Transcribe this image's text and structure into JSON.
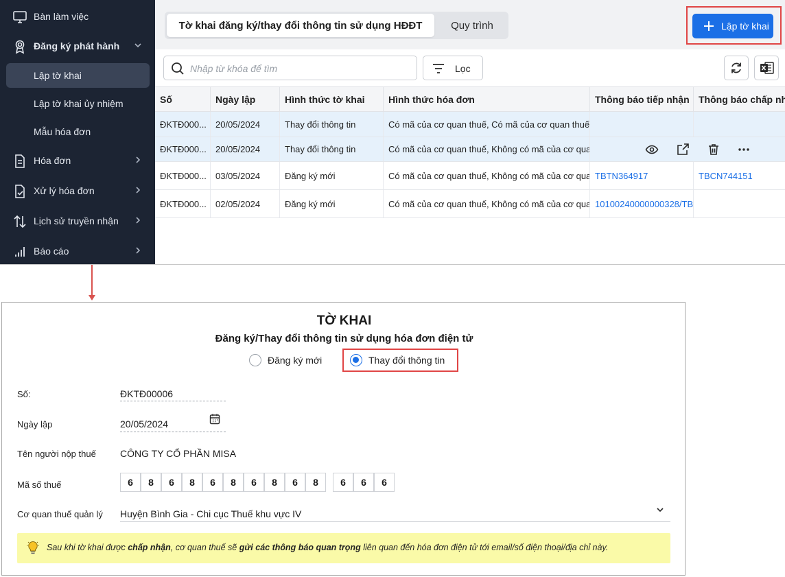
{
  "sidebar": {
    "items": [
      {
        "label": "Bàn làm việc",
        "icon": "monitor-icon"
      },
      {
        "label": "Đăng ký phát hành",
        "icon": "badge-icon"
      },
      {
        "label": "Hóa đơn",
        "icon": "document-icon"
      },
      {
        "label": "Xử lý hóa đơn",
        "icon": "document-check-icon"
      },
      {
        "label": "Lịch sử truyền nhận",
        "icon": "transfer-icon"
      },
      {
        "label": "Báo cáo",
        "icon": "bar-chart-icon"
      }
    ],
    "subitems": [
      {
        "label": "Lập tờ khai",
        "active": true
      },
      {
        "label": "Lập tờ khai ủy nhiệm",
        "active": false
      },
      {
        "label": "Mẫu hóa đơn",
        "active": false
      }
    ]
  },
  "header": {
    "tabs": [
      {
        "label": "Tờ khai đăng ký/thay đổi thông tin sử dụng HĐĐT",
        "active": true
      },
      {
        "label": "Quy trình",
        "active": false
      }
    ],
    "create_button": "Lập tờ khai"
  },
  "toolbar": {
    "search_placeholder": "Nhập từ khóa để tìm",
    "filter_label": "Lọc"
  },
  "table": {
    "columns": [
      "Số",
      "Ngày lập",
      "Hình thức tờ khai",
      "Hình thức hóa đơn",
      "Thông báo tiếp nhận",
      "Thông báo chấp nhận"
    ],
    "rows": [
      {
        "so": "ĐKTĐ000...",
        "ngay": "20/05/2024",
        "hinh_thuc": "Thay đổi thông tin",
        "hoa_don": "Có mã của cơ quan thuế, Có mã của cơ quan thuế (...",
        "tiep_nhan": "",
        "chap_nhan": ""
      },
      {
        "so": "ĐKTĐ000...",
        "ngay": "20/05/2024",
        "hinh_thuc": "Thay đổi thông tin",
        "hoa_don": "Có mã của cơ quan thuế, Không có mã của cơ quan...",
        "tiep_nhan": "",
        "chap_nhan": ""
      },
      {
        "so": "ĐKTĐ000...",
        "ngay": "03/05/2024",
        "hinh_thuc": "Đăng ký mới",
        "hoa_don": "Có mã của cơ quan thuế, Không có mã của cơ quan...",
        "tiep_nhan": "TBTN364917",
        "chap_nhan": "TBCN744151"
      },
      {
        "so": "ĐKTĐ000...",
        "ngay": "02/05/2024",
        "hinh_thuc": "Đăng ký mới",
        "hoa_don": "Có mã của cơ quan thuế, Không có mã của cơ quan...",
        "tiep_nhan": "10100240000000328/TB",
        "chap_nhan": ""
      }
    ]
  },
  "form": {
    "title": "TỜ KHAI",
    "subtitle": "Đăng ký/Thay đổi thông tin sử dụng hóa đơn điện tử",
    "radio_options": [
      {
        "label": "Đăng ký mới",
        "checked": false
      },
      {
        "label": "Thay đổi thông tin",
        "checked": true
      }
    ],
    "so_label": "Số:",
    "so_value": "ĐKTĐ00006",
    "ngay_label": "Ngày lập",
    "ngay_value": "20/05/2024",
    "ten_label": "Tên người nộp thuế",
    "ten_value": "CÔNG TY CỔ PHẦN MISA",
    "mst_label": "Mã số thuế",
    "mst_digits_main": [
      "6",
      "8",
      "6",
      "8",
      "6",
      "8",
      "6",
      "8",
      "6",
      "8"
    ],
    "mst_digits_branch": [
      "6",
      "6",
      "6"
    ],
    "cqt_label": "Cơ quan thuế quản lý",
    "cqt_value": "Huyện Bình Gia - Chi cục Thuế khu vực IV",
    "note_part1": "Sau khi tờ khai được ",
    "note_bold1": "chấp nhận",
    "note_part2": ", cơ quan thuế sẽ ",
    "note_bold2": "gửi các thông báo quan trọng",
    "note_part3": " liên quan đến hóa đơn điện tử tới email/số điện thoại/địa chỉ này."
  },
  "colors": {
    "sidebar_bg": "#1c2433",
    "accent": "#1b6fe6",
    "highlight_border": "#e04545",
    "note_bg": "#fafaa8"
  }
}
